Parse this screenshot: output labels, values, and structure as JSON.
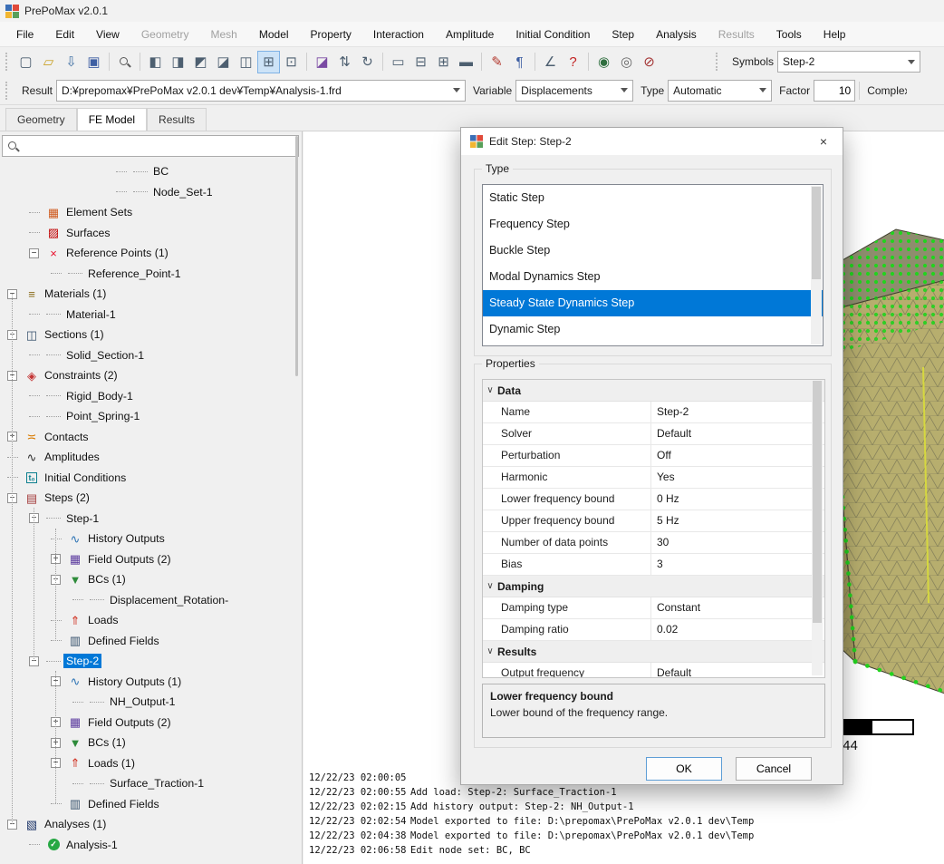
{
  "window": {
    "title": "PrePoMax v2.0.1"
  },
  "menu": {
    "items": [
      {
        "label": "File",
        "enabled": true
      },
      {
        "label": "Edit",
        "enabled": true
      },
      {
        "label": "View",
        "enabled": true
      },
      {
        "label": "Geometry",
        "enabled": false
      },
      {
        "label": "Mesh",
        "enabled": false
      },
      {
        "label": "Model",
        "enabled": true
      },
      {
        "label": "Property",
        "enabled": true
      },
      {
        "label": "Interaction",
        "enabled": true
      },
      {
        "label": "Amplitude",
        "enabled": true
      },
      {
        "label": "Initial Condition",
        "enabled": true
      },
      {
        "label": "Step",
        "enabled": true
      },
      {
        "label": "Analysis",
        "enabled": true
      },
      {
        "label": "Results",
        "enabled": false
      },
      {
        "label": "Tools",
        "enabled": true
      },
      {
        "label": "Help",
        "enabled": true
      }
    ]
  },
  "toolbar1": {
    "items": [
      {
        "type": "btn",
        "name": "new-model-button",
        "glyph": "▢"
      },
      {
        "type": "btn",
        "name": "open-file-button",
        "glyph": "▱",
        "color": "#c9a227"
      },
      {
        "type": "btn",
        "name": "import-file-button",
        "glyph": "⇩",
        "color": "#3e6fa3"
      },
      {
        "type": "btn",
        "name": "save-file-button",
        "glyph": "▣",
        "color": "#3e5fa3"
      },
      {
        "type": "sep"
      },
      {
        "type": "btn",
        "name": "zoom-button",
        "mag": true
      },
      {
        "type": "sep"
      },
      {
        "type": "btn",
        "name": "view-front-button",
        "glyph": "◧"
      },
      {
        "type": "btn",
        "name": "view-back-button",
        "glyph": "◨"
      },
      {
        "type": "btn",
        "name": "view-top-button",
        "glyph": "◩"
      },
      {
        "type": "btn",
        "name": "view-bottom-button",
        "glyph": "◪"
      },
      {
        "type": "btn",
        "name": "view-left-button",
        "glyph": "◫"
      },
      {
        "type": "btn",
        "name": "view-isometric-button",
        "glyph": "⊞",
        "pressed": true
      },
      {
        "type": "btn",
        "name": "view-fit-button",
        "glyph": "⊡"
      },
      {
        "type": "sep"
      },
      {
        "type": "btn",
        "name": "section-view-button",
        "glyph": "◪",
        "color": "#7a4aa3"
      },
      {
        "type": "btn",
        "name": "explode-view-button",
        "glyph": "⇅"
      },
      {
        "type": "btn",
        "name": "rotate-view-button",
        "glyph": "↻"
      },
      {
        "type": "sep"
      },
      {
        "type": "btn",
        "name": "wireframe-button",
        "glyph": "▭"
      },
      {
        "type": "btn",
        "name": "show-edges-button",
        "glyph": "⊟"
      },
      {
        "type": "btn",
        "name": "show-mesh-button",
        "glyph": "⊞"
      },
      {
        "type": "btn",
        "name": "show-solid-button",
        "glyph": "▬"
      },
      {
        "type": "sep"
      },
      {
        "type": "btn",
        "name": "edit-model-button",
        "glyph": "✎",
        "color": "#b3392f"
      },
      {
        "type": "btn",
        "name": "edit-keyword-button",
        "glyph": "¶",
        "color": "#3e5fa3"
      },
      {
        "type": "sep"
      },
      {
        "type": "btn",
        "name": "measure-button",
        "glyph": "∠"
      },
      {
        "type": "btn",
        "name": "query-button",
        "glyph": "?",
        "color": "#c22222"
      },
      {
        "type": "sep"
      },
      {
        "type": "btn",
        "name": "show-all-button",
        "glyph": "◉",
        "color": "#2f6f3f"
      },
      {
        "type": "btn",
        "name": "hide-button",
        "glyph": "◎",
        "color": "#666666"
      },
      {
        "type": "btn",
        "name": "show-only-button",
        "glyph": "⊘",
        "color": "#a33333"
      }
    ],
    "symbols_label": "Symbols",
    "symbols_value": "Step-2"
  },
  "toolbar2": {
    "result_label": "Result",
    "result_value": "D:¥prepomax¥PrePoMax v2.0.1 dev¥Temp¥Analysis-1.frd",
    "variable_label": "Variable",
    "variable_value": "Displacements",
    "type_label": "Type",
    "type_value": "Automatic",
    "factor_label": "Factor",
    "factor_value": "10",
    "complex_label": "Complex"
  },
  "tabs": [
    {
      "label": "Geometry",
      "active": false
    },
    {
      "label": "FE Model",
      "active": true
    },
    {
      "label": "Results",
      "active": false
    }
  ],
  "search": {
    "value": ""
  },
  "tree": {
    "icon_map": {
      "element-sets": {
        "glyph": "▦",
        "color": "#cf5b20"
      },
      "surfaces": {
        "glyph": "▨",
        "color": "#c00000"
      },
      "reference-points": {
        "glyph": "×",
        "color": "#e8112d"
      },
      "materials": {
        "glyph": "≡",
        "color": "#8a6d1a"
      },
      "sections": {
        "glyph": "◫",
        "color": "#35506b"
      },
      "constraints": {
        "glyph": "◈",
        "color": "#c43535"
      },
      "contacts": {
        "glyph": "≍",
        "color": "#d97b00"
      },
      "amplitudes": {
        "glyph": "∿",
        "color": "#2f2f2f"
      },
      "initial-conditions": {
        "glyph": "t₀",
        "color": "#0b7f8e",
        "box": true
      },
      "steps": {
        "glyph": "▤",
        "color": "#a33b3b"
      },
      "history-outputs": {
        "glyph": "∿",
        "color": "#2e74b5"
      },
      "field-outputs": {
        "glyph": "▦",
        "color": "#5b3a9e"
      },
      "bcs": {
        "glyph": "▼",
        "color": "#2e8b3a"
      },
      "loads": {
        "glyph": "⇑",
        "color": "#d03020"
      },
      "defined-fields": {
        "glyph": "▥",
        "color": "#35506b"
      },
      "analyses": {
        "glyph": "▧",
        "color": "#20386b"
      },
      "analysis-ok": {
        "glyph": "✓",
        "color": "#ffffff",
        "bg": "#27a844",
        "round": true
      }
    },
    "items": [
      {
        "label": "BC",
        "level": 5
      },
      {
        "label": "Node_Set-1",
        "level": 5
      },
      {
        "label": "Element Sets",
        "level": 1,
        "icon": "element-sets"
      },
      {
        "label": "Surfaces",
        "level": 1,
        "icon": "surfaces"
      },
      {
        "label": "Reference Points (1)",
        "level": 1,
        "exp": "minus",
        "icon": "reference-points"
      },
      {
        "label": "Reference_Point-1",
        "level": 2
      },
      {
        "label": "Materials (1)",
        "level": 0,
        "exp": "minus",
        "icon": "materials"
      },
      {
        "label": "Material-1",
        "level": 1
      },
      {
        "label": "Sections (1)",
        "level": 0,
        "exp": "minus",
        "icon": "sections"
      },
      {
        "label": "Solid_Section-1",
        "level": 1
      },
      {
        "label": "Constraints (2)",
        "level": 0,
        "exp": "minus",
        "icon": "constraints"
      },
      {
        "label": "Rigid_Body-1",
        "level": 1
      },
      {
        "label": "Point_Spring-1",
        "level": 1
      },
      {
        "label": "Contacts",
        "level": 0,
        "exp": "plus",
        "icon": "contacts"
      },
      {
        "label": "Amplitudes",
        "level": 0,
        "icon": "amplitudes"
      },
      {
        "label": "Initial Conditions",
        "level": 0,
        "icon": "initial-conditions"
      },
      {
        "label": "Steps (2)",
        "level": 0,
        "exp": "minus",
        "icon": "steps"
      },
      {
        "label": "Step-1",
        "level": 1,
        "exp": "minus"
      },
      {
        "label": "History Outputs",
        "level": 2,
        "icon": "history-outputs"
      },
      {
        "label": "Field Outputs (2)",
        "level": 2,
        "exp": "plus",
        "icon": "field-outputs"
      },
      {
        "label": "BCs (1)",
        "level": 2,
        "exp": "minus",
        "icon": "bcs"
      },
      {
        "label": "Displacement_Rotation-",
        "level": 3
      },
      {
        "label": "Loads",
        "level": 2,
        "icon": "loads"
      },
      {
        "label": "Defined Fields",
        "level": 2,
        "icon": "defined-fields"
      },
      {
        "label": "Step-2",
        "level": 1,
        "exp": "minus",
        "selected": true
      },
      {
        "label": "History Outputs (1)",
        "level": 2,
        "exp": "minus",
        "icon": "history-outputs"
      },
      {
        "label": "NH_Output-1",
        "level": 3
      },
      {
        "label": "Field Outputs (2)",
        "level": 2,
        "exp": "plus",
        "icon": "field-outputs"
      },
      {
        "label": "BCs (1)",
        "level": 2,
        "exp": "plus",
        "icon": "bcs"
      },
      {
        "label": "Loads (1)",
        "level": 2,
        "exp": "minus",
        "icon": "loads"
      },
      {
        "label": "Surface_Traction-1",
        "level": 3
      },
      {
        "label": "Defined Fields",
        "level": 2,
        "icon": "defined-fields"
      },
      {
        "label": "Analyses (1)",
        "level": 0,
        "exp": "minus",
        "icon": "analyses"
      },
      {
        "label": "Analysis-1",
        "level": 1,
        "icon": "analysis-ok"
      }
    ]
  },
  "dialog": {
    "title": "Edit Step: Step-2",
    "type_group": {
      "label": "Type",
      "options": [
        "Static Step",
        "Frequency Step",
        "Buckle Step",
        "Modal Dynamics Step",
        "Steady State Dynamics Step",
        "Dynamic Step"
      ],
      "selected_index": 4
    },
    "properties_group": {
      "label": "Properties",
      "rows": [
        {
          "kind": "category",
          "label": "Data"
        },
        {
          "kind": "prop",
          "name": "Name",
          "value": "Step-2"
        },
        {
          "kind": "prop",
          "name": "Solver",
          "value": "Default"
        },
        {
          "kind": "prop",
          "name": "Perturbation",
          "value": "Off"
        },
        {
          "kind": "prop",
          "name": "Harmonic",
          "value": "Yes"
        },
        {
          "kind": "prop",
          "name": "Lower frequency bound",
          "value": "0 Hz"
        },
        {
          "kind": "prop",
          "name": "Upper frequency bound",
          "value": "5 Hz"
        },
        {
          "kind": "prop",
          "name": "Number of data points",
          "value": "30"
        },
        {
          "kind": "prop",
          "name": "Bias",
          "value": "3"
        },
        {
          "kind": "category",
          "label": "Damping"
        },
        {
          "kind": "prop",
          "name": "Damping type",
          "value": "Constant"
        },
        {
          "kind": "prop",
          "name": "Damping ratio",
          "value": "0.02"
        },
        {
          "kind": "category",
          "label": "Results"
        },
        {
          "kind": "prop",
          "name": "Output frequency",
          "value": "Default"
        }
      ],
      "description_title": "Lower frequency bound",
      "description_text": "Lower bound of the frequency range."
    },
    "ok_label": "OK",
    "cancel_label": "Cancel"
  },
  "viewport": {
    "scale_value": "44"
  },
  "log": {
    "rows": [
      {
        "time": "12/22/23 02:00:05",
        "message": ""
      },
      {
        "time": "12/22/23 02:00:55",
        "message": "Add load: Step-2: Surface_Traction-1"
      },
      {
        "time": "12/22/23 02:02:15",
        "message": "Add history output: Step-2: NH_Output-1"
      },
      {
        "time": "12/22/23 02:02:54",
        "message": "Model exported to file: D:\\prepomax\\PrePoMax v2.0.1 dev\\Temp"
      },
      {
        "time": "12/22/23 02:04:38",
        "message": "Model exported to file: D:\\prepomax\\PrePoMax v2.0.1 dev\\Temp"
      },
      {
        "time": "12/22/23 02:06:58",
        "message": "Edit node set: BC, BC"
      }
    ]
  }
}
